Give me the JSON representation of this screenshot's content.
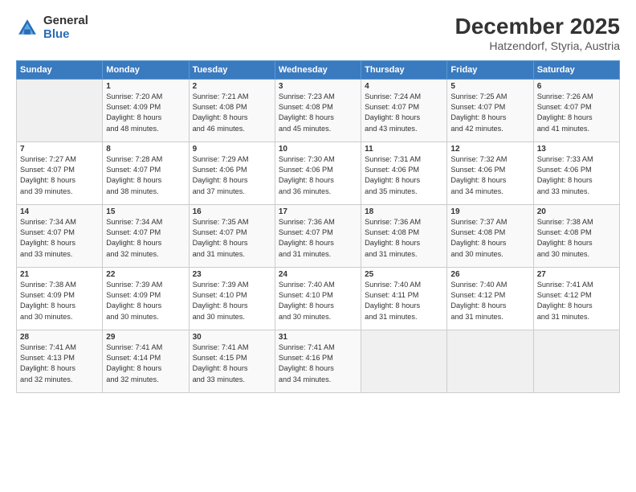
{
  "header": {
    "logo_general": "General",
    "logo_blue": "Blue",
    "month": "December 2025",
    "location": "Hatzendorf, Styria, Austria"
  },
  "days_of_week": [
    "Sunday",
    "Monday",
    "Tuesday",
    "Wednesday",
    "Thursday",
    "Friday",
    "Saturday"
  ],
  "weeks": [
    [
      {
        "day": "",
        "info": ""
      },
      {
        "day": "1",
        "info": "Sunrise: 7:20 AM\nSunset: 4:09 PM\nDaylight: 8 hours\nand 48 minutes."
      },
      {
        "day": "2",
        "info": "Sunrise: 7:21 AM\nSunset: 4:08 PM\nDaylight: 8 hours\nand 46 minutes."
      },
      {
        "day": "3",
        "info": "Sunrise: 7:23 AM\nSunset: 4:08 PM\nDaylight: 8 hours\nand 45 minutes."
      },
      {
        "day": "4",
        "info": "Sunrise: 7:24 AM\nSunset: 4:07 PM\nDaylight: 8 hours\nand 43 minutes."
      },
      {
        "day": "5",
        "info": "Sunrise: 7:25 AM\nSunset: 4:07 PM\nDaylight: 8 hours\nand 42 minutes."
      },
      {
        "day": "6",
        "info": "Sunrise: 7:26 AM\nSunset: 4:07 PM\nDaylight: 8 hours\nand 41 minutes."
      }
    ],
    [
      {
        "day": "7",
        "info": "Sunrise: 7:27 AM\nSunset: 4:07 PM\nDaylight: 8 hours\nand 39 minutes."
      },
      {
        "day": "8",
        "info": "Sunrise: 7:28 AM\nSunset: 4:07 PM\nDaylight: 8 hours\nand 38 minutes."
      },
      {
        "day": "9",
        "info": "Sunrise: 7:29 AM\nSunset: 4:06 PM\nDaylight: 8 hours\nand 37 minutes."
      },
      {
        "day": "10",
        "info": "Sunrise: 7:30 AM\nSunset: 4:06 PM\nDaylight: 8 hours\nand 36 minutes."
      },
      {
        "day": "11",
        "info": "Sunrise: 7:31 AM\nSunset: 4:06 PM\nDaylight: 8 hours\nand 35 minutes."
      },
      {
        "day": "12",
        "info": "Sunrise: 7:32 AM\nSunset: 4:06 PM\nDaylight: 8 hours\nand 34 minutes."
      },
      {
        "day": "13",
        "info": "Sunrise: 7:33 AM\nSunset: 4:06 PM\nDaylight: 8 hours\nand 33 minutes."
      }
    ],
    [
      {
        "day": "14",
        "info": "Sunrise: 7:34 AM\nSunset: 4:07 PM\nDaylight: 8 hours\nand 33 minutes."
      },
      {
        "day": "15",
        "info": "Sunrise: 7:34 AM\nSunset: 4:07 PM\nDaylight: 8 hours\nand 32 minutes."
      },
      {
        "day": "16",
        "info": "Sunrise: 7:35 AM\nSunset: 4:07 PM\nDaylight: 8 hours\nand 31 minutes."
      },
      {
        "day": "17",
        "info": "Sunrise: 7:36 AM\nSunset: 4:07 PM\nDaylight: 8 hours\nand 31 minutes."
      },
      {
        "day": "18",
        "info": "Sunrise: 7:36 AM\nSunset: 4:08 PM\nDaylight: 8 hours\nand 31 minutes."
      },
      {
        "day": "19",
        "info": "Sunrise: 7:37 AM\nSunset: 4:08 PM\nDaylight: 8 hours\nand 30 minutes."
      },
      {
        "day": "20",
        "info": "Sunrise: 7:38 AM\nSunset: 4:08 PM\nDaylight: 8 hours\nand 30 minutes."
      }
    ],
    [
      {
        "day": "21",
        "info": "Sunrise: 7:38 AM\nSunset: 4:09 PM\nDaylight: 8 hours\nand 30 minutes."
      },
      {
        "day": "22",
        "info": "Sunrise: 7:39 AM\nSunset: 4:09 PM\nDaylight: 8 hours\nand 30 minutes."
      },
      {
        "day": "23",
        "info": "Sunrise: 7:39 AM\nSunset: 4:10 PM\nDaylight: 8 hours\nand 30 minutes."
      },
      {
        "day": "24",
        "info": "Sunrise: 7:40 AM\nSunset: 4:10 PM\nDaylight: 8 hours\nand 30 minutes."
      },
      {
        "day": "25",
        "info": "Sunrise: 7:40 AM\nSunset: 4:11 PM\nDaylight: 8 hours\nand 31 minutes."
      },
      {
        "day": "26",
        "info": "Sunrise: 7:40 AM\nSunset: 4:12 PM\nDaylight: 8 hours\nand 31 minutes."
      },
      {
        "day": "27",
        "info": "Sunrise: 7:41 AM\nSunset: 4:12 PM\nDaylight: 8 hours\nand 31 minutes."
      }
    ],
    [
      {
        "day": "28",
        "info": "Sunrise: 7:41 AM\nSunset: 4:13 PM\nDaylight: 8 hours\nand 32 minutes."
      },
      {
        "day": "29",
        "info": "Sunrise: 7:41 AM\nSunset: 4:14 PM\nDaylight: 8 hours\nand 32 minutes."
      },
      {
        "day": "30",
        "info": "Sunrise: 7:41 AM\nSunset: 4:15 PM\nDaylight: 8 hours\nand 33 minutes."
      },
      {
        "day": "31",
        "info": "Sunrise: 7:41 AM\nSunset: 4:16 PM\nDaylight: 8 hours\nand 34 minutes."
      },
      {
        "day": "",
        "info": ""
      },
      {
        "day": "",
        "info": ""
      },
      {
        "day": "",
        "info": ""
      }
    ]
  ]
}
